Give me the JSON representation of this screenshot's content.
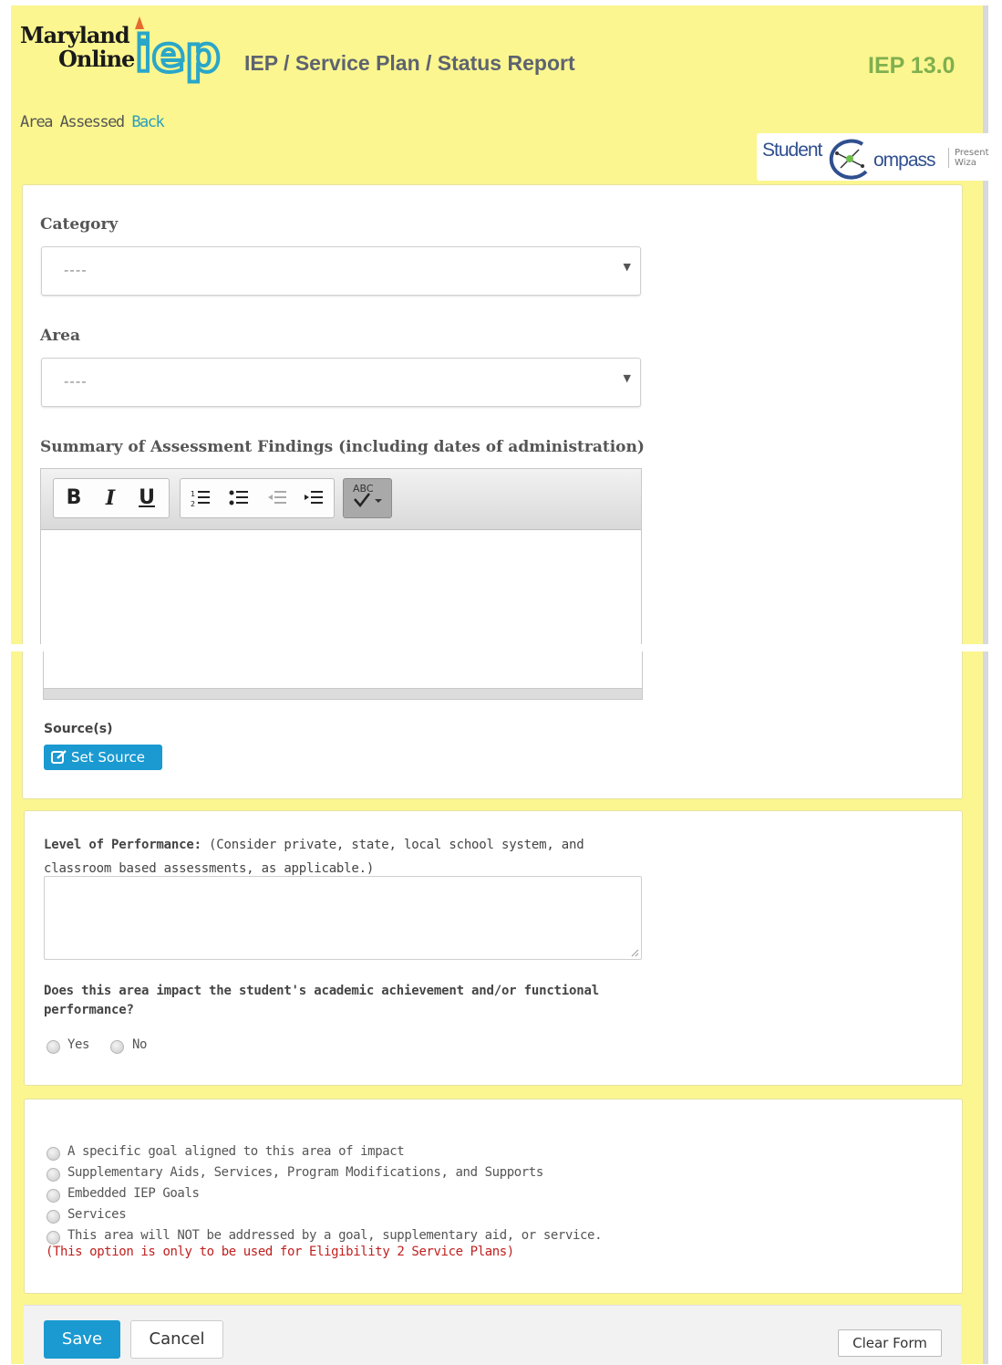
{
  "header": {
    "logo_line1": "Maryland",
    "logo_line2": "Online",
    "logo_iep": "iep",
    "title": "IEP / Service Plan / Status Report",
    "version": "IEP 13.0",
    "breadcrumb_current": "Area Assessed",
    "breadcrumb_back": "Back",
    "compass_student": "Student",
    "compass_ompass": "ompass",
    "compass_present_1": "Present",
    "compass_present_2": "Wiza"
  },
  "form": {
    "category_label": "Category",
    "category_value": "----",
    "area_label": "Area",
    "area_value": "----",
    "summary_label": "Summary of Assessment Findings (including dates of administration)",
    "toolbar": {
      "bold": "B",
      "italic": "I",
      "underline": "U",
      "spellcheck": "ABC"
    },
    "sources_label": "Source(s)",
    "set_source_label": "Set Source"
  },
  "performance": {
    "label_bold": "Level of Performance:",
    "label_rest_1": " (Consider private, state, local school system, and",
    "label_rest_2": "classroom based assessments, as applicable.)",
    "impact_question_1": "Does this area impact the student's academic achievement and/or functional",
    "impact_question_2": "performance?",
    "yes": "Yes",
    "no": "No"
  },
  "options": {
    "items": [
      "A specific goal aligned to this area of impact",
      "Supplementary Aids, Services, Program Modifications, and Supports",
      "Embedded IEP Goals",
      "Services",
      "This area will NOT be addressed by a goal, supplementary aid, or service."
    ],
    "note": "(This option is only to be used for Eligibility 2 Service Plans)"
  },
  "footer": {
    "save": "Save",
    "cancel": "Cancel",
    "clear": "Clear Form"
  },
  "colors": {
    "page_background": "#fbf68f",
    "accent_blue": "#1a9ad1",
    "version_green": "#7faf4f",
    "note_red": "#c0201f"
  }
}
